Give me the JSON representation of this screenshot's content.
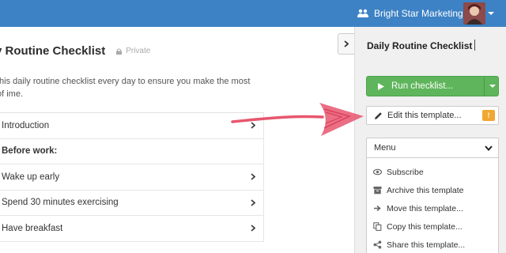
{
  "topbar": {
    "org_name": "Bright Star Marketing",
    "org_icon": "users-icon",
    "avatar_icon": "avatar"
  },
  "main": {
    "title": "y Routine Checklist",
    "privacy": "Private",
    "description": "this daily routine checklist every day to ensure you make the most of ime.",
    "items": [
      {
        "label": "Introduction",
        "heading": false
      },
      {
        "label": "Before work:",
        "heading": true
      },
      {
        "label": "Wake up early",
        "heading": false
      },
      {
        "label": "Spend 30 minutes exercising",
        "heading": false
      },
      {
        "label": "Have breakfast",
        "heading": false
      }
    ]
  },
  "sidebar": {
    "title": "Daily Routine Checklist",
    "run_label": "Run checklist...",
    "edit_label": "Edit this template...",
    "edit_badge": "!",
    "menu_label": "Menu",
    "menu_items": [
      {
        "label": "Subscribe",
        "icon": "eye-icon"
      },
      {
        "label": "Archive this template",
        "icon": "archive-icon"
      },
      {
        "label": "Move this template...",
        "icon": "arrow-right-icon"
      },
      {
        "label": "Copy this template...",
        "icon": "copy-icon"
      },
      {
        "label": "Share this template...",
        "icon": "share-icon"
      }
    ]
  },
  "colors": {
    "topbar": "#3d82c4",
    "run_button": "#5fb55b",
    "badge": "#f0a830",
    "annotation_arrow": "#e8566e"
  }
}
